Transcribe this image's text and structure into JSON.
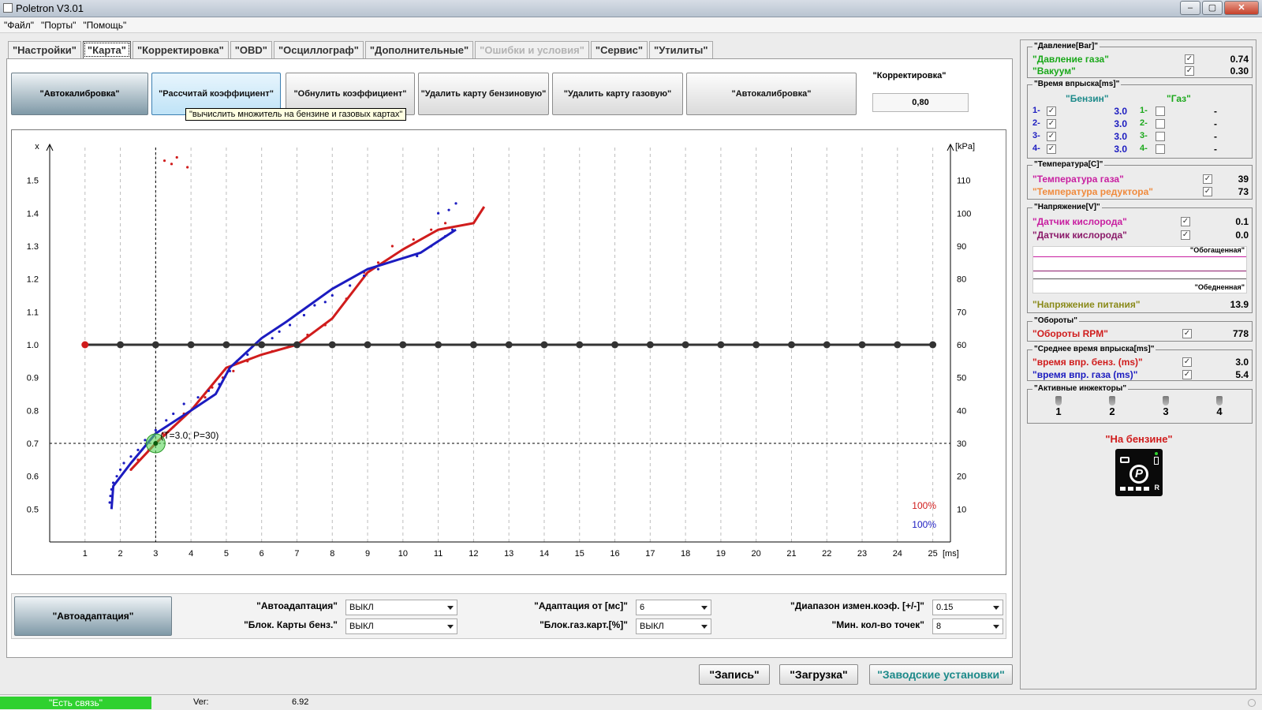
{
  "window": {
    "title": "Poletron V3.01",
    "min": "–",
    "max": "▢",
    "close": "✕"
  },
  "menu": [
    "\"Файл\"",
    "\"Порты\"",
    "\"Помощь\""
  ],
  "tabs": [
    {
      "label": "\"Настройки\"",
      "state": "normal"
    },
    {
      "label": "\"Карта\"",
      "state": "active"
    },
    {
      "label": "\"Корректировка\"",
      "state": "normal"
    },
    {
      "label": "\"OBD\"",
      "state": "normal"
    },
    {
      "label": "\"Осциллограф\"",
      "state": "normal"
    },
    {
      "label": "\"Дополнительные\"",
      "state": "normal"
    },
    {
      "label": "\"Ошибки и условия\"",
      "state": "disabled"
    },
    {
      "label": "\"Сервис\"",
      "state": "normal"
    },
    {
      "label": "\"Утилиты\"",
      "state": "normal"
    }
  ],
  "toolbar": {
    "autocalib_left": "\"Автокалибровка\"",
    "calc_coef": "\"Рассчитай коэффициент\"",
    "reset_coef": "\"Обнулить коэффициент\"",
    "del_petrol_map": "\"Удалить карту бензиновую\"",
    "del_gas_map": "\"Удалить карту газовую\"",
    "autocalib_right": "\"Автокалибровка\"",
    "tooltip": "\"вычислить множитель на бензине и газовых картах\"",
    "correction_label": "\"Корректировка\"",
    "correction_value": "0,80"
  },
  "chart_data": {
    "type": "line",
    "xlabel": "[ms]",
    "ylabel_left": "x",
    "ylabel_right": "[kPa]",
    "x_ticks": [
      1,
      2,
      3,
      4,
      5,
      6,
      7,
      8,
      9,
      10,
      11,
      12,
      13,
      14,
      15,
      16,
      17,
      18,
      19,
      20,
      21,
      22,
      23,
      24,
      25
    ],
    "y_ticks_left": [
      "1.5",
      "1.4",
      "1.3",
      "1.2",
      "1.1",
      "1.0",
      "0.9",
      "0.8",
      "0.7",
      "0.6",
      "0.5"
    ],
    "y_ticks_right": [
      "110",
      "100",
      "90",
      "80",
      "70",
      "60",
      "50",
      "40",
      "30",
      "20",
      "10"
    ],
    "xlim": [
      0,
      25.5
    ],
    "ylim_right": [
      0,
      120
    ],
    "grid": true,
    "cursor": {
      "x": 3.0,
      "p": 30,
      "label": "(T=3.0; P=30)"
    },
    "legend": [
      {
        "label": "100%",
        "color": "#d01c1c"
      },
      {
        "label": "100%",
        "color": "#1c1cc0"
      }
    ],
    "series": [
      {
        "color": "#d01c1c",
        "line": [
          [
            2.3,
            22
          ],
          [
            3,
            30
          ],
          [
            4,
            40
          ],
          [
            5,
            53
          ],
          [
            6,
            57
          ],
          [
            7,
            60
          ],
          [
            8,
            68
          ],
          [
            9,
            82
          ],
          [
            10,
            89
          ],
          [
            11,
            95
          ],
          [
            12,
            97
          ],
          [
            12.3,
            102
          ]
        ],
        "points": [
          [
            2.3,
            22
          ],
          [
            2.5,
            25
          ],
          [
            2.8,
            28
          ],
          [
            3.2,
            33
          ],
          [
            3.5,
            35
          ],
          [
            3.8,
            39
          ],
          [
            4.1,
            41
          ],
          [
            4.4,
            44
          ],
          [
            4.6,
            47
          ],
          [
            4.9,
            50
          ],
          [
            5.2,
            52
          ],
          [
            5.6,
            55
          ],
          [
            6.3,
            58
          ],
          [
            6.8,
            60
          ],
          [
            7.3,
            63
          ],
          [
            7.8,
            66
          ],
          [
            8.4,
            74
          ],
          [
            8.9,
            82
          ],
          [
            9.3,
            85
          ],
          [
            9.7,
            90
          ],
          [
            10.3,
            92
          ],
          [
            10.8,
            95
          ],
          [
            11.2,
            97
          ],
          [
            3.25,
            116
          ],
          [
            3.45,
            115
          ],
          [
            3.6,
            117
          ],
          [
            3.9,
            114
          ]
        ]
      },
      {
        "color": "#1c1cc0",
        "line": [
          [
            1.75,
            10
          ],
          [
            1.8,
            17
          ],
          [
            2.3,
            24
          ],
          [
            3,
            33
          ],
          [
            4,
            40
          ],
          [
            4.7,
            45
          ],
          [
            5.1,
            53
          ],
          [
            6,
            62
          ],
          [
            6.7,
            67
          ],
          [
            8,
            77
          ],
          [
            9,
            83
          ],
          [
            10.5,
            88
          ],
          [
            11.5,
            95
          ]
        ],
        "points": [
          [
            1.7,
            12
          ],
          [
            1.72,
            14
          ],
          [
            1.75,
            16
          ],
          [
            1.8,
            18
          ],
          [
            1.9,
            20
          ],
          [
            2.0,
            22
          ],
          [
            2.1,
            24
          ],
          [
            2.3,
            26
          ],
          [
            2.5,
            28
          ],
          [
            2.7,
            31
          ],
          [
            3.0,
            34
          ],
          [
            3.3,
            37
          ],
          [
            3.5,
            39
          ],
          [
            3.8,
            42
          ],
          [
            4.2,
            44
          ],
          [
            4.5,
            46
          ],
          [
            4.8,
            48
          ],
          [
            5.1,
            52
          ],
          [
            5.3,
            55
          ],
          [
            5.6,
            57
          ],
          [
            5.9,
            60
          ],
          [
            6.3,
            62
          ],
          [
            6.5,
            64
          ],
          [
            6.8,
            66
          ],
          [
            7.2,
            69
          ],
          [
            7.5,
            72
          ],
          [
            7.8,
            73
          ],
          [
            8.0,
            75
          ],
          [
            8.5,
            78
          ],
          [
            8.9,
            81
          ],
          [
            9.3,
            83
          ],
          [
            10.4,
            87
          ],
          [
            10.8,
            90
          ],
          [
            11.2,
            93
          ],
          [
            11.4,
            95
          ],
          [
            11.0,
            100
          ],
          [
            11.3,
            101
          ],
          [
            11.5,
            103
          ]
        ]
      },
      {
        "color": "#333333",
        "line": [
          [
            1,
            60
          ],
          [
            25,
            60
          ]
        ],
        "points": [
          [
            1,
            60
          ],
          [
            2,
            60
          ],
          [
            3,
            60
          ],
          [
            4,
            60
          ],
          [
            5,
            60
          ],
          [
            6,
            60
          ],
          [
            7,
            60
          ],
          [
            8,
            60
          ],
          [
            9,
            60
          ],
          [
            10,
            60
          ],
          [
            11,
            60
          ],
          [
            12,
            60
          ],
          [
            13,
            60
          ],
          [
            14,
            60
          ],
          [
            15,
            60
          ],
          [
            16,
            60
          ],
          [
            17,
            60
          ],
          [
            18,
            60
          ],
          [
            19,
            60
          ],
          [
            20,
            60
          ],
          [
            21,
            60
          ],
          [
            22,
            60
          ],
          [
            23,
            60
          ],
          [
            24,
            60
          ],
          [
            25,
            60
          ]
        ]
      }
    ]
  },
  "bottom": {
    "autoadapt_btn": "\"Автоадаптация\"",
    "autoadapt_label": "\"Автоадаптация\"",
    "autoadapt_value": "ВЫКЛ",
    "block_petrol_label": "\"Блок. Карты бенз.\"",
    "block_petrol_value": "ВЫКЛ",
    "adapt_from_label": "\"Адаптация от [мс]\"",
    "adapt_from_value": "6",
    "block_gas_label": "\"Блок.газ.карт.[%]\"",
    "block_gas_value": "ВЫКЛ",
    "range_label": "\"Диапазон измен.коэф. [+/-]\"",
    "range_value": "0.15",
    "min_points_label": "\"Мин. кол-во точек\"",
    "min_points_value": "8"
  },
  "footer": {
    "write": "\"Запись\"",
    "load": "\"Загрузка\"",
    "factory": "\"Заводские установки\""
  },
  "status": {
    "connection": "\"Есть связь\"",
    "ver_label": "Ver:",
    "ver_value": "6.92"
  },
  "right": {
    "pressure": {
      "title": "\"Давление[Bar]\"",
      "gas_label": "\"Давление газа\"",
      "gas_value": "0.74",
      "vacuum_label": "\"Вакуум\"",
      "vacuum_value": "0.30"
    },
    "injection": {
      "title": "\"Время впрыска[ms]\"",
      "petrol_header": "\"Бензин\"",
      "gas_header": "\"Газ\"",
      "rows": [
        {
          "pn": "1-",
          "pv": "3.0",
          "gn": "1-",
          "gv": "-"
        },
        {
          "pn": "2-",
          "pv": "3.0",
          "gn": "2-",
          "gv": "-"
        },
        {
          "pn": "3-",
          "pv": "3.0",
          "gn": "3-",
          "gv": "-"
        },
        {
          "pn": "4-",
          "pv": "3.0",
          "gn": "4-",
          "gv": "-"
        }
      ]
    },
    "temperature": {
      "title": "\"Температура[C]\"",
      "gas_label": "\"Температура газа\"",
      "gas_value": "39",
      "reducer_label": "\"Температура редуктора\"",
      "reducer_value": "73"
    },
    "voltage": {
      "title": "\"Напряжение[V]\"",
      "o2a_label": "\"Датчик кислорода\"",
      "o2a_value": "0.1",
      "o2b_label": "\"Датчик кислорода\"",
      "o2b_value": "0.0",
      "rich": "\"Обогащенная\"",
      "lean": "\"Обедненная\"",
      "supply_label": "\"Напряжение питания\"",
      "supply_value": "13.9"
    },
    "rpm": {
      "title": "\"Обороты\"",
      "label": "\"Обороты RPM\"",
      "value": "778"
    },
    "avg": {
      "title": "\"Среднее время впрыска[ms]\"",
      "petrol_label": "\"время впр. бенз. (ms)\"",
      "petrol_value": "3.0",
      "gas_label": "\"время впр. газа (ms)\"",
      "gas_value": "5.4"
    },
    "injectors": {
      "title": "\"Активные инжекторы\"",
      "items": [
        "1",
        "2",
        "3",
        "4"
      ]
    },
    "fuel_state": "\"На бензине\"",
    "switch_letter": "P",
    "switch_r": "R"
  },
  "colors": {
    "green": "#1aa81a",
    "magenta": "#c81ea0",
    "orange": "#f08a3c",
    "darkmagenta": "#8b1a6a",
    "red": "#d01c1c",
    "blue": "#1c1cc0",
    "olive": "#8a8a1a",
    "teal": "#1d8a8a"
  }
}
